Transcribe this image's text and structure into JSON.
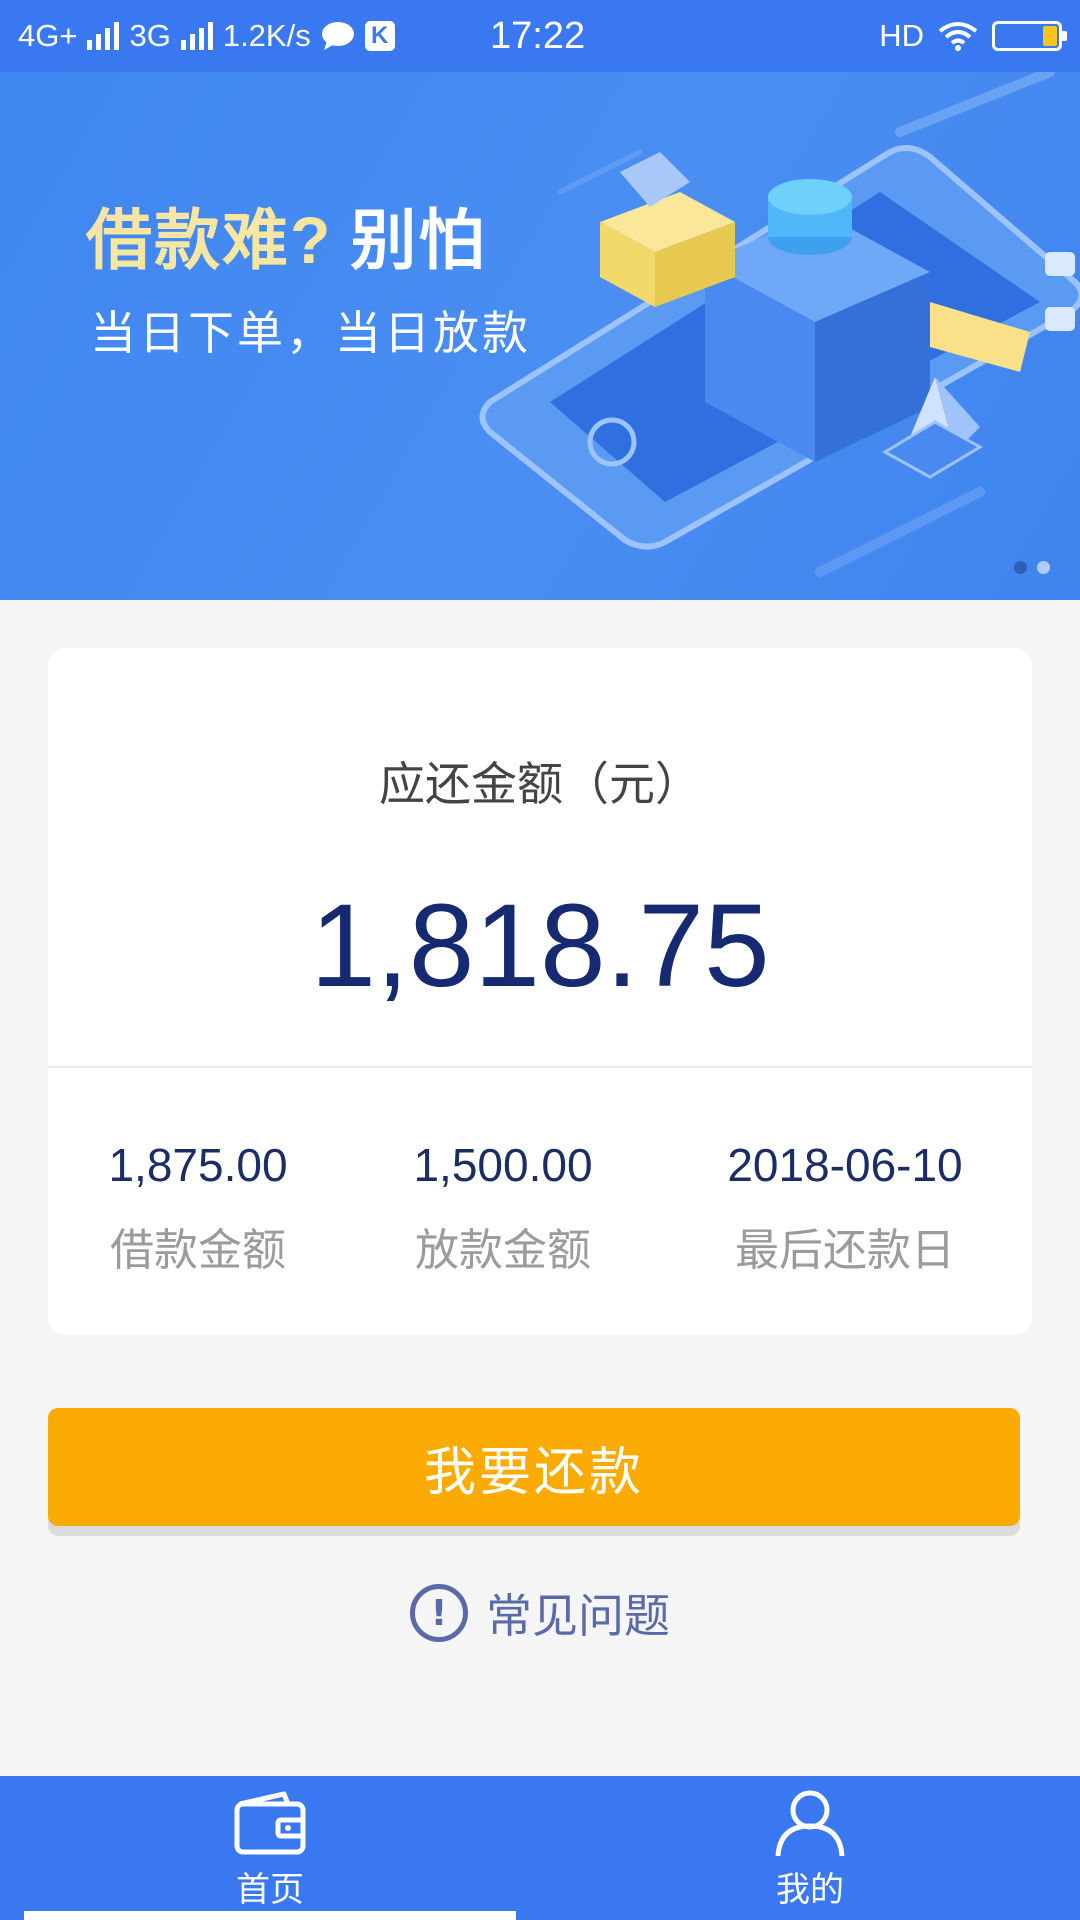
{
  "status_bar": {
    "network1": "4G+",
    "network2": "3G",
    "speed": "1.2K/s",
    "time": "17:22",
    "hd": "HD"
  },
  "banner": {
    "title_part1": "借款难?",
    "title_part2": "别怕",
    "subtitle": "当日下单，当日放款",
    "slide_count": 2,
    "active_slide": 1
  },
  "summary": {
    "label": "应还金额（元）",
    "amount": "1,818.75",
    "stats": [
      {
        "value": "1,875.00",
        "label": "借款金额"
      },
      {
        "value": "1,500.00",
        "label": "放款金额"
      },
      {
        "value": "2018-06-10",
        "label": "最后还款日"
      }
    ]
  },
  "actions": {
    "repay_label": "我要还款",
    "faq_label": "常见问题"
  },
  "nav": {
    "home_label": "首页",
    "mine_label": "我的",
    "active": "home"
  },
  "colors": {
    "primary": "#3a78f2",
    "button": "#fbab03",
    "amount": "#152a70"
  }
}
